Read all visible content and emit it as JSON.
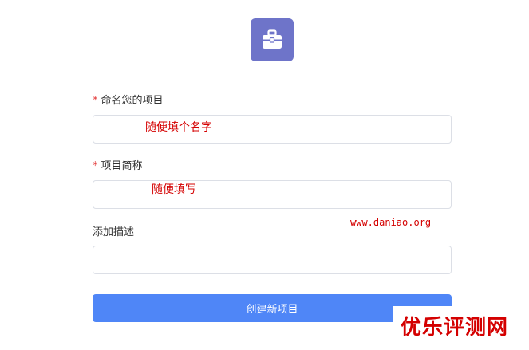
{
  "logo": {
    "icon": "briefcase-icon",
    "tile_color": "#6e74c9"
  },
  "form": {
    "project_name": {
      "required_mark": "*",
      "label": "命名您的项目",
      "value": "",
      "annotation": "随便填个名字"
    },
    "project_abbr": {
      "required_mark": "*",
      "label": "项目简称",
      "value": "",
      "annotation": "随便填写"
    },
    "description": {
      "label": "添加描述",
      "value": ""
    },
    "submit_label": "创建新项目"
  },
  "watermark": {
    "url": "www.daniao.org",
    "brand": "优乐评测网"
  },
  "colors": {
    "accent": "#4f86f7",
    "annotation": "#d40000",
    "required": "#e33b3b"
  }
}
